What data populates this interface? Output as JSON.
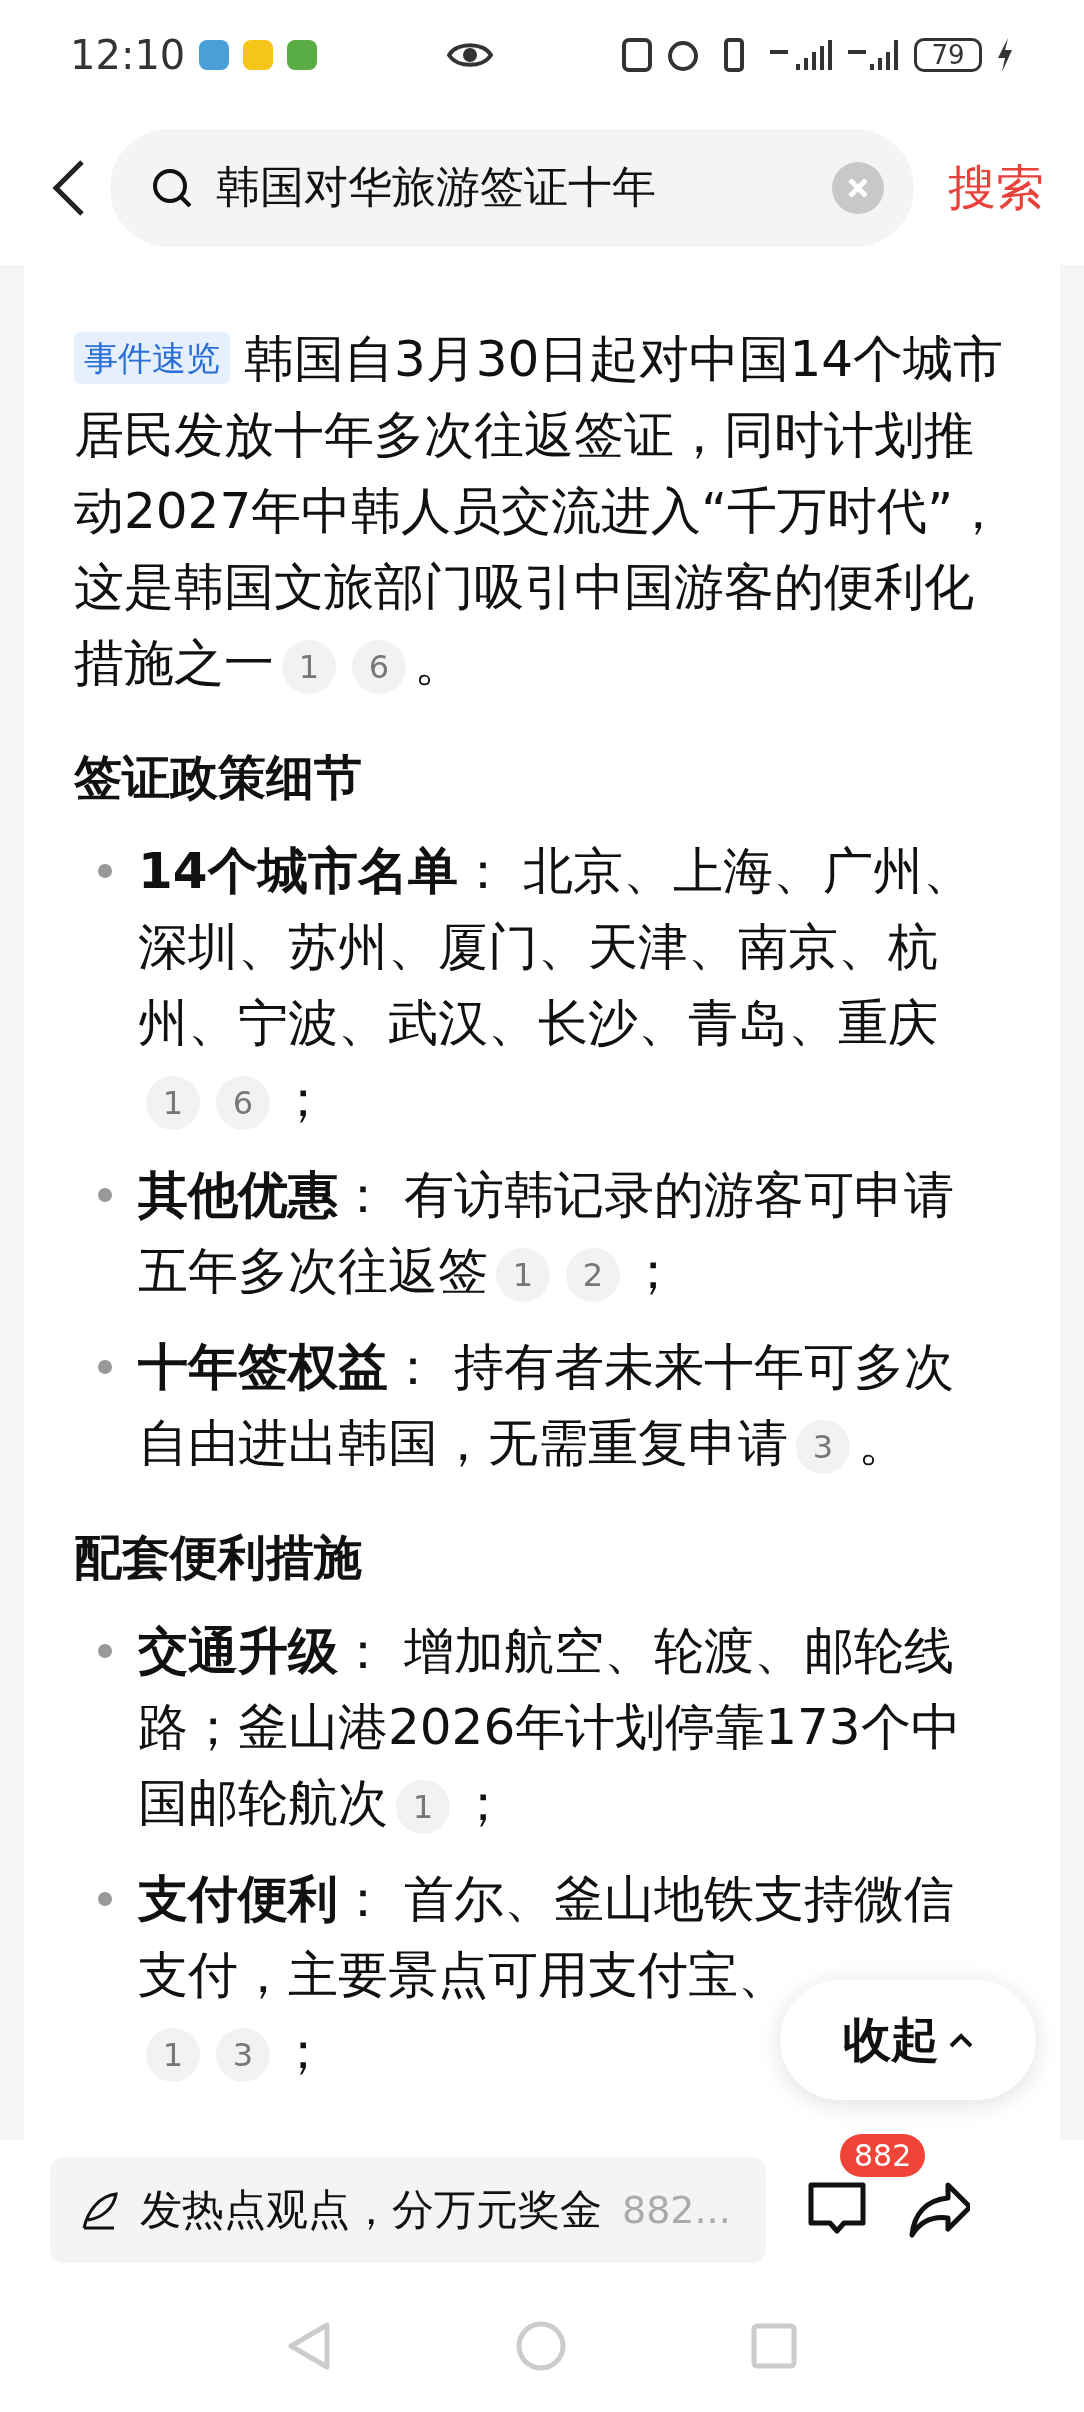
{
  "status_bar": {
    "time": "12:10",
    "battery": "79"
  },
  "search": {
    "query": "韩国对华旅游签证十年",
    "button": "搜索"
  },
  "summary": {
    "tag": "事件速览",
    "text": "韩国自3月30日起对中国14个城市居民发放十年多次往返签证，同时计划推动2027年中韩人员交流进入“千万时代”，这是韩国文旅部门吸引中国游客的便利化措施之一",
    "citations": [
      "1",
      "6"
    ],
    "end": "。"
  },
  "sections": [
    {
      "heading": "签证政策细节",
      "items": [
        {
          "label": "14个城市名单",
          "text": "： 北京、上海、广州、深圳、苏州、厦门、天津、南京、杭州、宁波、武汉、长沙、青岛、重庆",
          "citations": [
            "1",
            "6"
          ],
          "end": "；"
        },
        {
          "label": "其他优惠",
          "text": "： 有访韩记录的游客可申请五年多次往返签",
          "citations": [
            "1",
            "2"
          ],
          "end": "；"
        },
        {
          "label": "十年签权益",
          "text": "： 持有者未来十年可多次自由进出韩国，无需重复申请",
          "citations": [
            "3"
          ],
          "end": "。"
        }
      ]
    },
    {
      "heading": "配套便利措施",
      "items": [
        {
          "label": "交通升级",
          "text": "： 增加航空、轮渡、邮轮线路；釜山港2026年计划停靠173个中国邮轮航次",
          "citations": [
            "1"
          ],
          "end": "；"
        },
        {
          "label": "支付便利",
          "text": "： 首尔、釜山地铁支持微信支付，主要景点可用支付宝、",
          "citations": [
            "1",
            "3"
          ],
          "end": "；"
        }
      ]
    }
  ],
  "collapse_button": "收起",
  "comment_bar": {
    "placeholder": "发热点观点，分万元奖金",
    "count_hint": "882...",
    "badge": "882"
  }
}
